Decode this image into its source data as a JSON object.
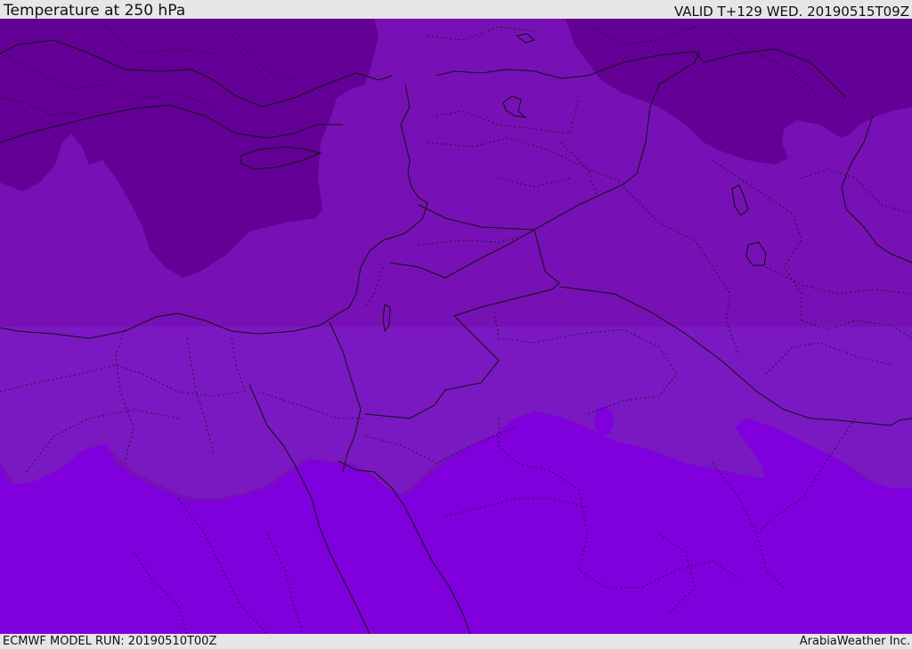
{
  "header": {
    "title": "Temperature at 250 hPa",
    "valid": "VALID T+129 WED. 20190515T09Z"
  },
  "footer": {
    "model_run": "ECMWF MODEL RUN: 20190510T00Z",
    "credit": "ArabiaWeather Inc."
  },
  "map": {
    "field": "temperature",
    "level": "250 hPa",
    "colors": {
      "coldest": "#640096",
      "cold": "#7711b5",
      "mid": "#7a19c2",
      "warm": "#7f00dd",
      "border": "#111111"
    }
  }
}
